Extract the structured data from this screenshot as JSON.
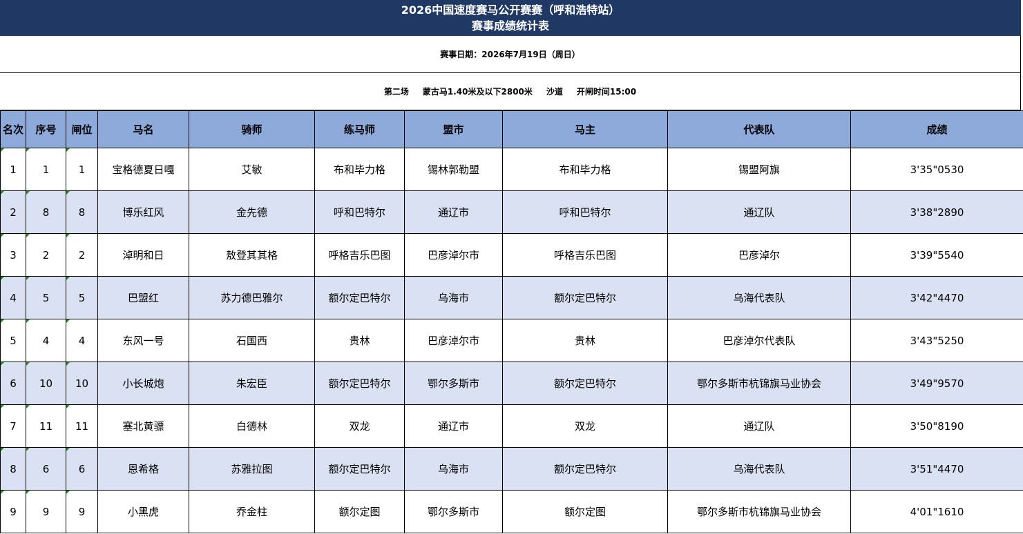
{
  "title": {
    "line1": "2026中国速度赛马公开赛赛（呼和浩特站）",
    "line2": "赛事成绩统计表"
  },
  "date_line": "赛事日期：2026年7月19日（周日）",
  "race_info": {
    "round": "第二场",
    "category": "蒙古马1.40米及以下2800米",
    "surface": "沙道",
    "start": "开闸时间15:00"
  },
  "columns": [
    "名次",
    "序号",
    "闸位",
    "马名",
    "骑师",
    "练马师",
    "盟市",
    "马主",
    "代表队",
    "成绩"
  ],
  "rows": [
    [
      "1",
      "1",
      "1",
      "宝格德夏日嘎",
      "艾敏",
      "布和毕力格",
      "锡林郭勒盟",
      "布和毕力格",
      "锡盟阿旗",
      "3'35\"0530"
    ],
    [
      "2",
      "8",
      "8",
      "博乐红风",
      "金先德",
      "呼和巴特尔",
      "通辽市",
      "呼和巴特尔",
      "通辽队",
      "3'38\"2890"
    ],
    [
      "3",
      "2",
      "2",
      "淖明和日",
      "敖登其其格",
      "呼格吉乐巴图",
      "巴彦淖尔市",
      "呼格吉乐巴图",
      "巴彦淖尔",
      "3'39\"5540"
    ],
    [
      "4",
      "5",
      "5",
      "巴盟红",
      "苏力德巴雅尔",
      "额尔定巴特尔",
      "乌海市",
      "额尔定巴特尔",
      "乌海代表队",
      "3'42\"4470"
    ],
    [
      "5",
      "4",
      "4",
      "东风一号",
      "石国西",
      "贵林",
      "巴彦淖尔市",
      "贵林",
      "巴彦淖尔代表队",
      "3'43\"5250"
    ],
    [
      "6",
      "10",
      "10",
      "小长城炮",
      "朱宏臣",
      "额尔定巴特尔",
      "鄂尔多斯市",
      "额尔定巴特尔",
      "鄂尔多斯市杭锦旗马业协会",
      "3'49\"9570"
    ],
    [
      "7",
      "11",
      "11",
      "塞北黄骠",
      "白德林",
      "双龙",
      "通辽市",
      "双龙",
      "通辽队",
      "3'50\"8190"
    ],
    [
      "8",
      "6",
      "6",
      "恩希格",
      "苏雅拉图",
      "额尔定巴特尔",
      "乌海市",
      "额尔定巴特尔",
      "乌海代表队",
      "3'51\"4470"
    ],
    [
      "9",
      "9",
      "9",
      "小黑虎",
      "乔金柱",
      "额尔定图",
      "鄂尔多斯市",
      "额尔定图",
      "鄂尔多斯市杭锦旗马业协会",
      "4'01\"1610"
    ]
  ],
  "colors": {
    "title_bg": "#1f3864",
    "header_bg": "#8eaadb",
    "alt_row_bg": "#d9e1f2",
    "cell_marker": "#1e8a1e"
  }
}
